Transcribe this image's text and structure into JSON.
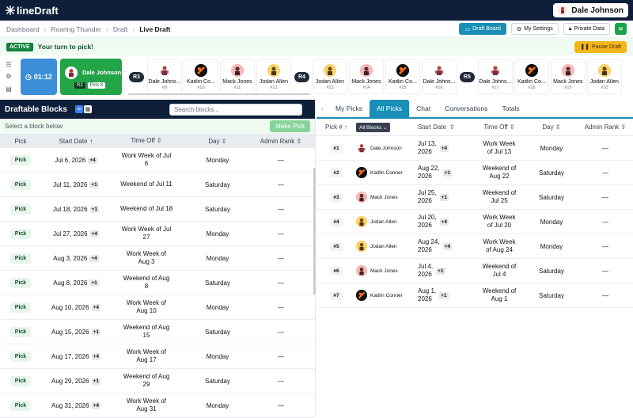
{
  "app": {
    "logo_text": "lineDraft",
    "user_name": "Dale Johnson"
  },
  "breadcrumb": [
    "Dashboard",
    "Roaring Thunder",
    "Draft",
    "Live Draft"
  ],
  "toolbar": {
    "draft_board": "Draft Board",
    "my_settings": "My Settings",
    "private_data": "Private Data",
    "pause": "Pause Draft"
  },
  "status": {
    "badge": "ACTIVE",
    "message": "Your turn to pick!"
  },
  "timer": "01:12",
  "on_clock": {
    "name": "Dale Johnson",
    "round": "R2",
    "pick": "Pick 8"
  },
  "round_labels": [
    "R3",
    "R4",
    "R5"
  ],
  "draft_cards": [
    {
      "name": "Dale Johns...",
      "no": "#9",
      "type": "dale"
    },
    {
      "name": "Kaitlin Co...",
      "no": "#10",
      "type": "kaitlin"
    },
    {
      "name": "Mack Jones",
      "no": "#11",
      "type": "mack"
    },
    {
      "name": "Jodan Allen",
      "no": "#12",
      "type": "jodan"
    },
    {
      "name": "Jodan Allen",
      "no": "#13",
      "type": "jodan"
    },
    {
      "name": "Mack Jones",
      "no": "#14",
      "type": "mack"
    },
    {
      "name": "Kaitlin Co...",
      "no": "#15",
      "type": "kaitlin"
    },
    {
      "name": "Dale Johns...",
      "no": "#16",
      "type": "dale"
    },
    {
      "name": "Dale Johns...",
      "no": "#17",
      "type": "dale"
    },
    {
      "name": "Kaitlin Co...",
      "no": "#18",
      "type": "kaitlin"
    },
    {
      "name": "Mack Jones",
      "no": "#19",
      "type": "mack"
    },
    {
      "name": "Jodan Allen",
      "no": "#20",
      "type": "jodan"
    }
  ],
  "left_panel": {
    "title": "Draftable Blocks",
    "search_placeholder": "Search blocks...",
    "hint": "Select a block below",
    "make_pick": "Make Pick",
    "headers": [
      "Pick",
      "Start Date",
      "Time Off",
      "Day",
      "Admin Rank"
    ],
    "pick_label": "Pick",
    "rows": [
      {
        "start": "Jul 6, 2026",
        "plus": "+4",
        "time": [
          "Work Week of Jul",
          "6"
        ],
        "day": "Monday",
        "rank": "—"
      },
      {
        "start": "Jul 11, 2026",
        "plus": "+1",
        "time": [
          "Weekend of Jul 11"
        ],
        "day": "Saturday",
        "rank": "—"
      },
      {
        "start": "Jul 18, 2026",
        "plus": "+1",
        "time": [
          "Weekend of Jul 18"
        ],
        "day": "Saturday",
        "rank": "—"
      },
      {
        "start": "Jul 27, 2026",
        "plus": "+4",
        "time": [
          "Work Week of Jul",
          "27"
        ],
        "day": "Monday",
        "rank": "—"
      },
      {
        "start": "Aug 3, 2026",
        "plus": "+4",
        "time": [
          "Work Week of",
          "Aug 3"
        ],
        "day": "Monday",
        "rank": "—"
      },
      {
        "start": "Aug 8, 2026",
        "plus": "+1",
        "time": [
          "Weekend of Aug",
          "8"
        ],
        "day": "Saturday",
        "rank": "—"
      },
      {
        "start": "Aug 10, 2026",
        "plus": "+4",
        "time": [
          "Work Week of",
          "Aug 10"
        ],
        "day": "Monday",
        "rank": "—"
      },
      {
        "start": "Aug 15, 2026",
        "plus": "+1",
        "time": [
          "Weekend of Aug",
          "15"
        ],
        "day": "Saturday",
        "rank": "—"
      },
      {
        "start": "Aug 17, 2026",
        "plus": "+4",
        "time": [
          "Work Week of",
          "Aug 17"
        ],
        "day": "Monday",
        "rank": "—"
      },
      {
        "start": "Aug 29, 2026",
        "plus": "+1",
        "time": [
          "Weekend of Aug",
          "29"
        ],
        "day": "Saturday",
        "rank": "—"
      },
      {
        "start": "Aug 31, 2026",
        "plus": "+4",
        "time": [
          "Work Week of",
          "Aug 31"
        ],
        "day": "Monday",
        "rank": "—"
      }
    ]
  },
  "right_panel": {
    "tabs": [
      "My Picks",
      "All Picks",
      "Chat",
      "Conversations",
      "Totals"
    ],
    "headers": [
      "Pick #",
      "All Blocks",
      "Start Date",
      "Time Off",
      "Day",
      "Admin Rank"
    ],
    "rows": [
      {
        "pick": "#1",
        "name": "Dale Johnson",
        "type": "dale",
        "start": [
          "Jul 13,",
          "2026"
        ],
        "plus": "+4",
        "time": [
          "Work Week",
          "of Jul 13"
        ],
        "day": "Monday",
        "rank": "—"
      },
      {
        "pick": "#2",
        "name": "Kaitlin Conner",
        "type": "kaitlin",
        "start": [
          "Aug 22,",
          "2026"
        ],
        "plus": "+1",
        "time": [
          "Weekend of",
          "Aug 22"
        ],
        "day": "Saturday",
        "rank": "—"
      },
      {
        "pick": "#3",
        "name": "Mack Jones",
        "type": "mack",
        "start": [
          "Jul 25,",
          "2026"
        ],
        "plus": "+1",
        "time": [
          "Weekend of",
          "Jul 25"
        ],
        "day": "Saturday",
        "rank": "—"
      },
      {
        "pick": "#4",
        "name": "Jodan Allen",
        "type": "jodan",
        "start": [
          "Jul 20,",
          "2026"
        ],
        "plus": "+4",
        "time": [
          "Work Week",
          "of Jul 20"
        ],
        "day": "Monday",
        "rank": "—"
      },
      {
        "pick": "#5",
        "name": "Jodan Allen",
        "type": "jodan",
        "start": [
          "Aug 24,",
          "2026"
        ],
        "plus": "+4",
        "time": [
          "Work Week",
          "of Aug 24"
        ],
        "day": "Monday",
        "rank": "—"
      },
      {
        "pick": "#6",
        "name": "Mack Jones",
        "type": "mack",
        "start": [
          "Jul 4,",
          "2026"
        ],
        "plus": "+1",
        "time": [
          "Weekend of",
          "Jul 4"
        ],
        "day": "Saturday",
        "rank": "—"
      },
      {
        "pick": "#7",
        "name": "Kaitlin Conner",
        "type": "kaitlin",
        "start": [
          "Aug 1,",
          "2026"
        ],
        "plus": "+1",
        "time": [
          "Weekend of",
          "Aug 1"
        ],
        "day": "Saturday",
        "rank": "—"
      }
    ]
  },
  "colors": {
    "navy": "#0f1f3a",
    "teal": "#1a8fb5",
    "green": "#22a447",
    "blue": "#3b8fd8",
    "gold": "#f3b71d"
  }
}
